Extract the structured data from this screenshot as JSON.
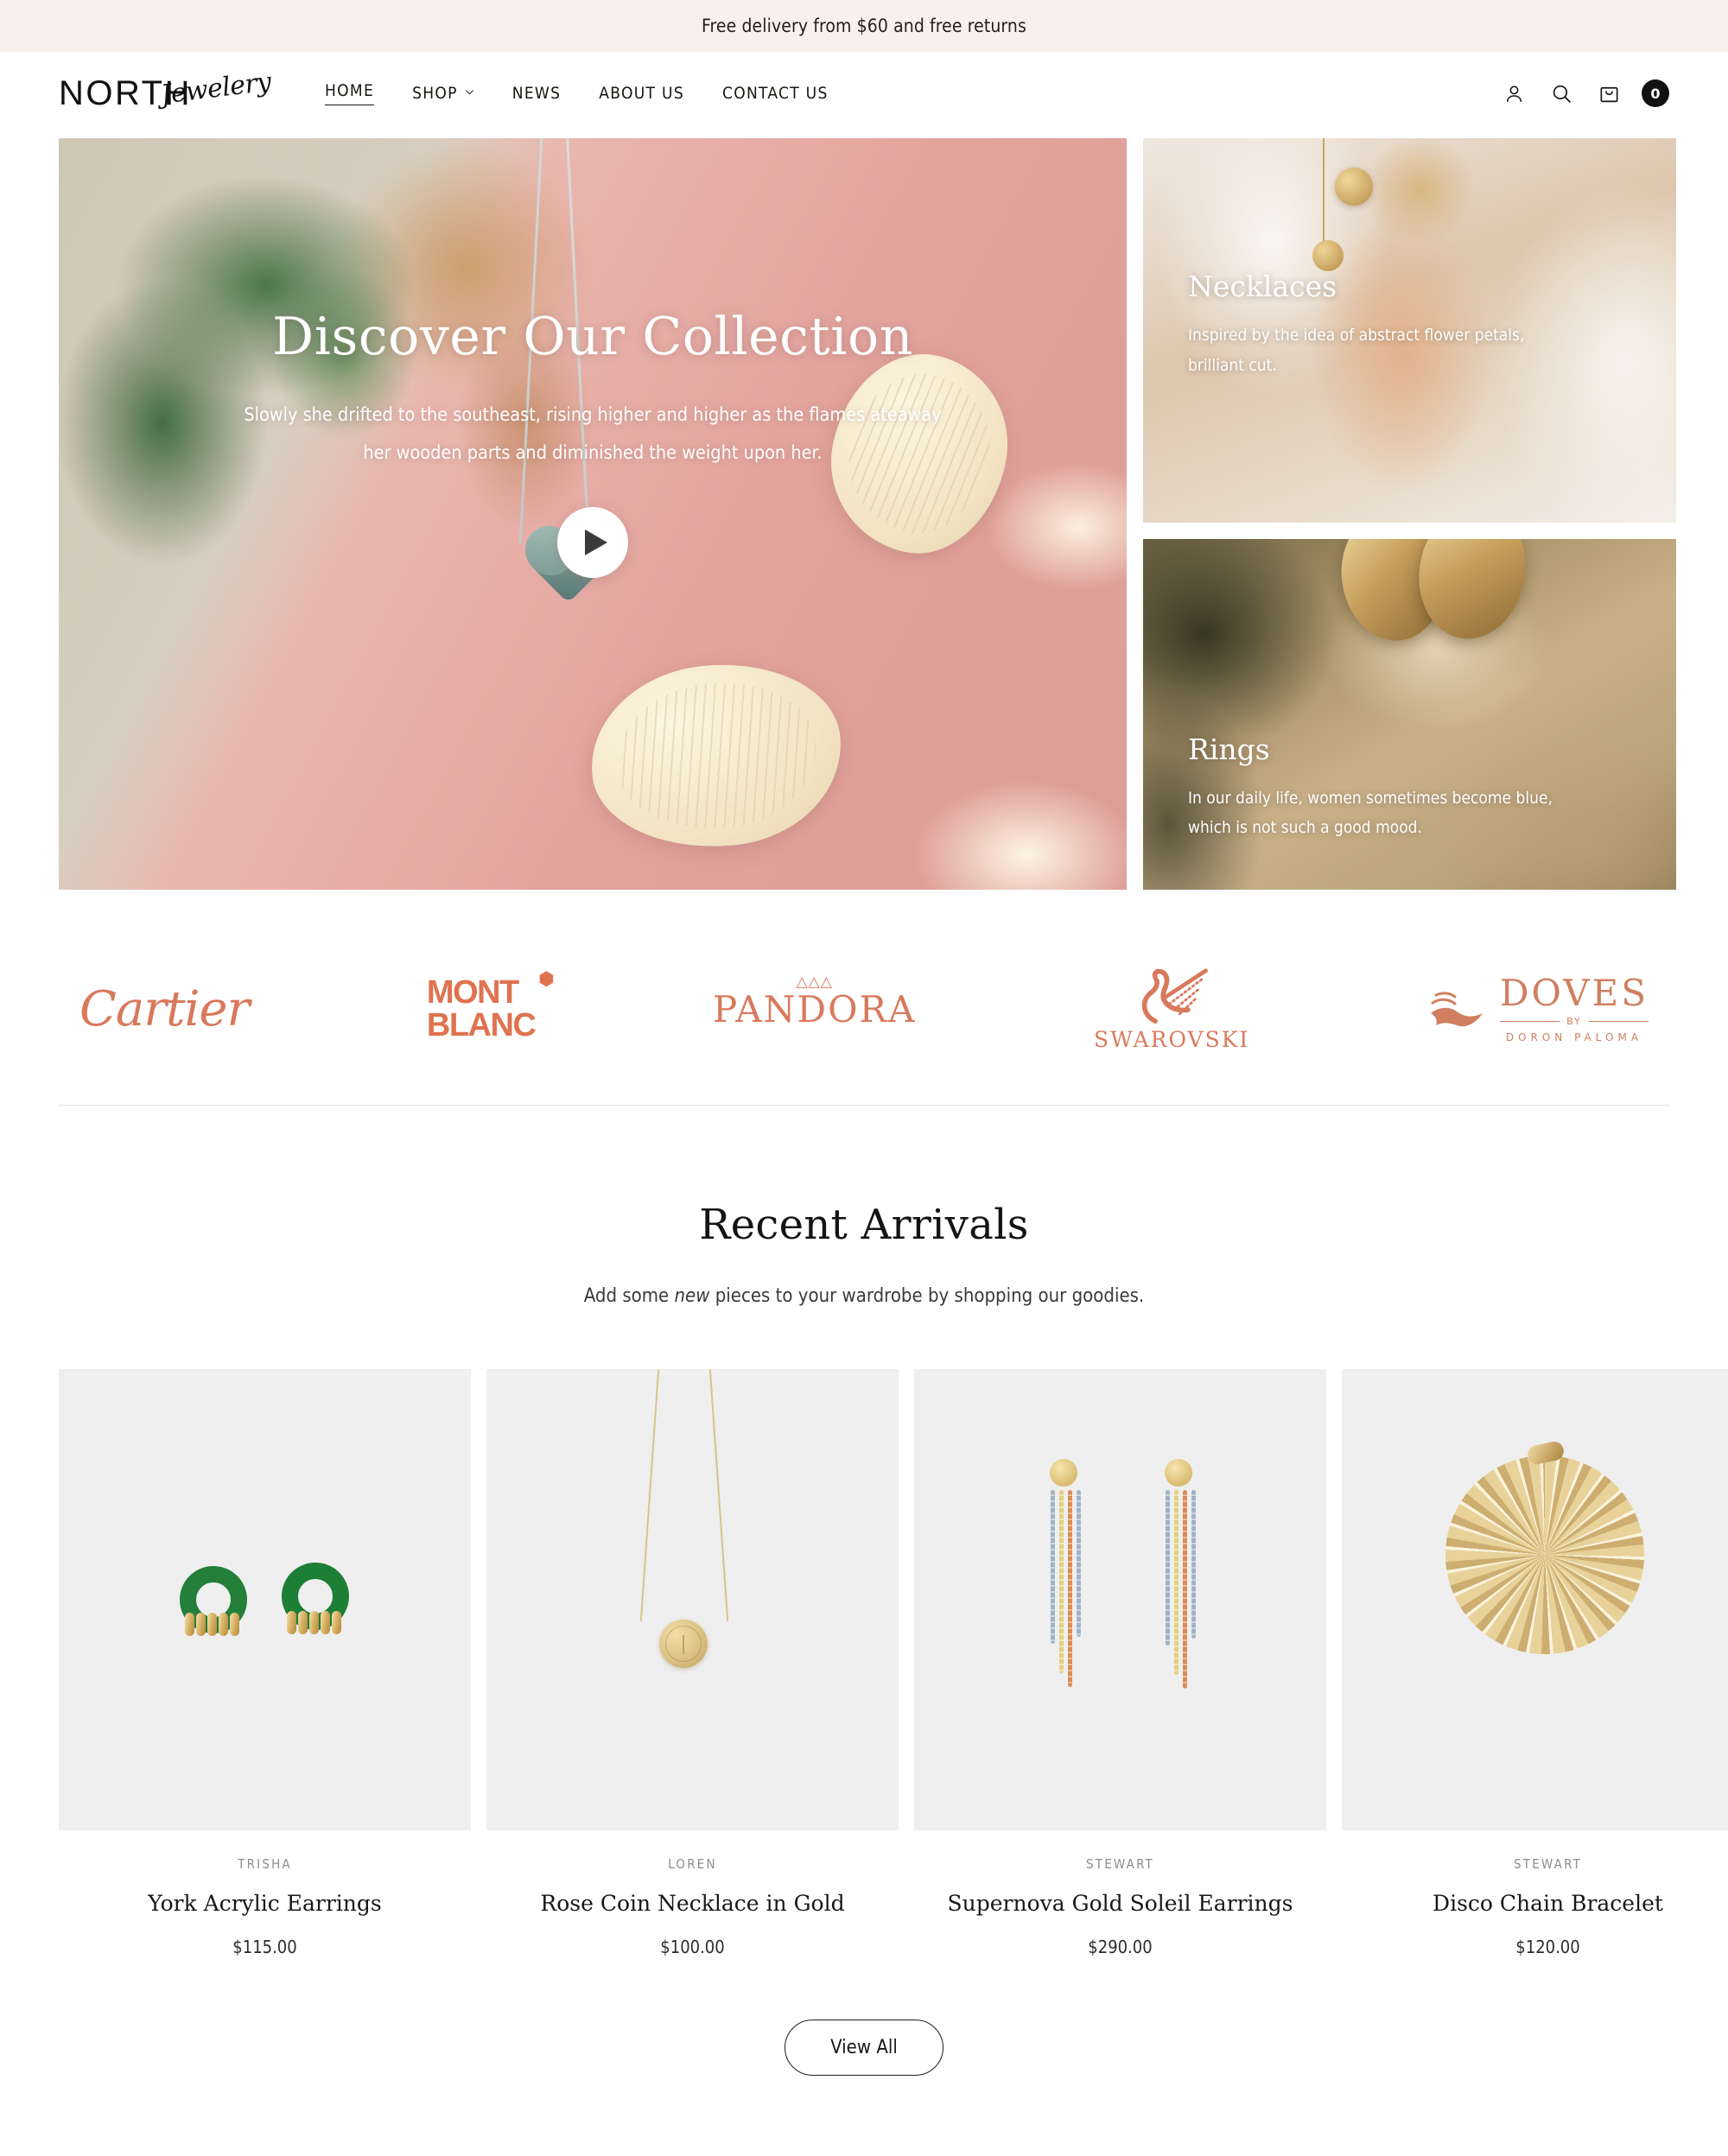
{
  "announcement": {
    "text": "Free delivery from $60 and free returns"
  },
  "header": {
    "logo": {
      "primary": "NORTH",
      "script": "Jewelery"
    },
    "nav": [
      {
        "label": "HOME",
        "active": true,
        "has_chevron": false
      },
      {
        "label": "SHOP",
        "active": false,
        "has_chevron": true
      },
      {
        "label": "NEWS",
        "active": false,
        "has_chevron": false
      },
      {
        "label": "ABOUT US",
        "active": false,
        "has_chevron": false
      },
      {
        "label": "CONTACT US",
        "active": false,
        "has_chevron": false
      }
    ],
    "icons": {
      "account": "account-icon",
      "search": "search-icon",
      "cart": "shopping-bag-icon"
    },
    "cart_count": "0"
  },
  "hero": {
    "title": "Discover Our Collection",
    "subtitle_line1": "Slowly she drifted to the southeast, rising higher and higher as the flames ateaway",
    "subtitle_line2": "her wooden parts and diminished the weight upon her.",
    "play_button": "play-icon"
  },
  "side_cards": [
    {
      "key": "necklaces",
      "title": "Necklaces",
      "desc_line1": "Inspired by the idea of abstract flower petals,",
      "desc_line2": "brilliant cut."
    },
    {
      "key": "rings",
      "title": "Rings",
      "desc_line1": "In our daily life, women sometimes become blue,",
      "desc_line2": "which is not such a good mood."
    }
  ],
  "brands": [
    {
      "name": "Cartier"
    },
    {
      "name": "MONT",
      "name2": "BLANC"
    },
    {
      "name": "PANDORA",
      "accent": "crown"
    },
    {
      "name": "SWAROVSKI"
    },
    {
      "name": "DOVES",
      "by": "BY",
      "sub": "DORON PALOMA"
    }
  ],
  "recent_arrivals": {
    "title": "Recent Arrivals",
    "subtitle_before": "Add some ",
    "subtitle_em": "new",
    "subtitle_after": " pieces to your wardrobe by shopping our goodies.",
    "view_all_label": "View All",
    "products": [
      {
        "vendor": "TRISHA",
        "title": "York Acrylic Earrings",
        "price": "$115.00"
      },
      {
        "vendor": "LOREN",
        "title": "Rose Coin Necklace in Gold",
        "price": "$100.00"
      },
      {
        "vendor": "STEWART",
        "title": "Supernova Gold Soleil Earrings",
        "price": "$290.00"
      },
      {
        "vendor": "STEWART",
        "title": "Disco Chain Bracelet",
        "price": "$120.00"
      }
    ]
  },
  "colors": {
    "announcement_bg": "#f9f0ee",
    "brand_accent": "#d9795c",
    "text": "#1a1a1a",
    "product_bg": "#efefef"
  }
}
